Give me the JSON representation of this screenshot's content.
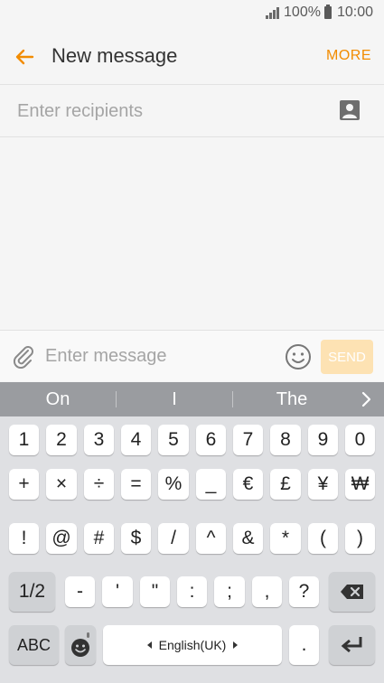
{
  "status_bar": {
    "battery_percent": "100%",
    "time": "10:00"
  },
  "app_bar": {
    "title": "New message",
    "more_label": "MORE"
  },
  "recipients": {
    "placeholder": "Enter recipients"
  },
  "compose": {
    "placeholder": "Enter message",
    "send_label": "SEND"
  },
  "suggestions": [
    "On",
    "I",
    "The"
  ],
  "keyboard": {
    "row1": [
      "1",
      "2",
      "3",
      "4",
      "5",
      "6",
      "7",
      "8",
      "9",
      "0"
    ],
    "row2": [
      "+",
      "×",
      "÷",
      "=",
      "%",
      "_",
      "€",
      "£",
      "¥",
      "₩"
    ],
    "row3": [
      "!",
      "@",
      "#",
      "$",
      "/",
      "^",
      "&",
      "*",
      "(",
      ")"
    ],
    "row4_mode": "1/2",
    "row4": [
      "-",
      "'",
      "\"",
      ":",
      ";",
      ",",
      "?"
    ],
    "abc_label": "ABC",
    "language_label": "English(UK)",
    "period_label": "."
  },
  "colors": {
    "accent": "#f28c00",
    "send_disabled": "#fde2b3",
    "suggestion_bar": "#9a9ca0",
    "keyboard_bg": "#dfe0e3"
  }
}
